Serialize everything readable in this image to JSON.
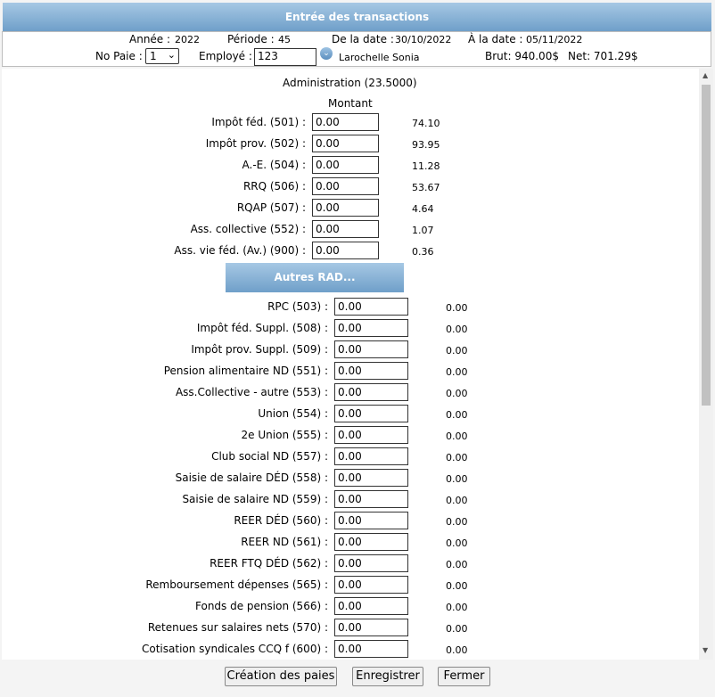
{
  "title": "Entrée des transactions",
  "header": {
    "annee_label": "Année :",
    "annee_value": "2022",
    "periode_label": "Période :",
    "periode_value": "45",
    "de_date_label": "De la date :",
    "de_date_value": "30/10/2022",
    "a_date_label": "À la date :",
    "a_date_value": "05/11/2022",
    "nopaie_label": "No Paie :",
    "nopaie_value": "1",
    "employe_label": "Employé :",
    "employe_value": "123",
    "employe_name": "Larochelle Sonia",
    "brut": "Brut: 940.00$",
    "net": "Net: 701.29$"
  },
  "section_title": "Administration (23.5000)",
  "montant_header": "Montant",
  "deductions": [
    {
      "label": "Impôt féd. (501) :",
      "value": "0.00",
      "amount": "74.10"
    },
    {
      "label": "Impôt prov. (502) :",
      "value": "0.00",
      "amount": "93.95"
    },
    {
      "label": "A.-E. (504) :",
      "value": "0.00",
      "amount": "11.28"
    },
    {
      "label": "RRQ (506) :",
      "value": "0.00",
      "amount": "53.67"
    },
    {
      "label": "RQAP (507) :",
      "value": "0.00",
      "amount": "4.64"
    },
    {
      "label": "Ass. collective (552) :",
      "value": "0.00",
      "amount": "1.07"
    },
    {
      "label": "Ass. vie féd. (Av.) (900) :",
      "value": "0.00",
      "amount": "0.36"
    }
  ],
  "autres_label": "Autres RAD...",
  "autres": [
    {
      "label": "RPC (503) :",
      "value": "0.00",
      "amount": "0.00"
    },
    {
      "label": "Impôt féd. Suppl. (508) :",
      "value": "0.00",
      "amount": "0.00"
    },
    {
      "label": "Impôt prov. Suppl. (509) :",
      "value": "0.00",
      "amount": "0.00"
    },
    {
      "label": "Pension alimentaire ND (551) :",
      "value": "0.00",
      "amount": "0.00"
    },
    {
      "label": "Ass.Collective - autre (553) :",
      "value": "0.00",
      "amount": "0.00"
    },
    {
      "label": "Union (554) :",
      "value": "0.00",
      "amount": "0.00"
    },
    {
      "label": "2e Union (555) :",
      "value": "0.00",
      "amount": "0.00"
    },
    {
      "label": "Club social ND (557) :",
      "value": "0.00",
      "amount": "0.00"
    },
    {
      "label": "Saisie de salaire DÉD (558) :",
      "value": "0.00",
      "amount": "0.00"
    },
    {
      "label": "Saisie de salaire ND (559) :",
      "value": "0.00",
      "amount": "0.00"
    },
    {
      "label": "REER DÉD (560) :",
      "value": "0.00",
      "amount": "0.00"
    },
    {
      "label": "REER ND (561) :",
      "value": "0.00",
      "amount": "0.00"
    },
    {
      "label": "REER FTQ DÉD (562) :",
      "value": "0.00",
      "amount": "0.00"
    },
    {
      "label": "Remboursement dépenses (565) :",
      "value": "0.00",
      "amount": "0.00"
    },
    {
      "label": "Fonds de pension (566) :",
      "value": "0.00",
      "amount": "0.00"
    },
    {
      "label": "Retenues sur salaires nets (570) :",
      "value": "0.00",
      "amount": "0.00"
    },
    {
      "label": "Cotisation syndicales CCQ f (600) :",
      "value": "0.00",
      "amount": "0.00"
    }
  ],
  "buttons": {
    "creation": "Création des paies",
    "enregistrer": "Enregistrer",
    "fermer": "Fermer"
  }
}
